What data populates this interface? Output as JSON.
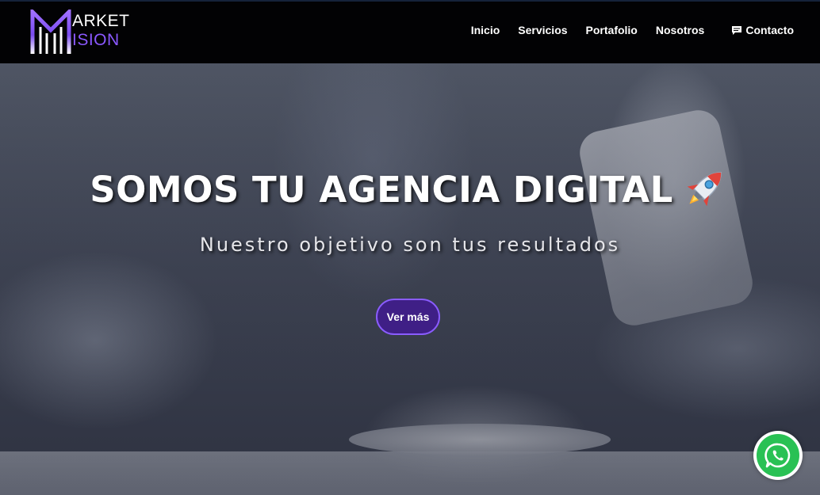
{
  "brand": {
    "mark_letter": "M",
    "logo_top": "ARKET",
    "logo_bottom": "ISION"
  },
  "nav": {
    "items": [
      {
        "label": "Inicio"
      },
      {
        "label": "Servicios"
      },
      {
        "label": "Portafolio"
      },
      {
        "label": "Nosotros"
      },
      {
        "label": "Contacto",
        "icon": "chat-icon"
      }
    ]
  },
  "hero": {
    "title": "SOMOS TU AGENCIA DIGITAL",
    "title_icon": "rocket-icon",
    "subtitle": "Nuestro objetivo son tus resultados",
    "cta_label": "Ver más",
    "background": "blurred-photo-hands-smartphone-coffee-cup"
  },
  "floating": {
    "whatsapp_icon": "whatsapp-icon"
  },
  "colors": {
    "navbar_bg": "#020204",
    "accent_purple": "#8a58ff",
    "cta_bg": "#3f1f86",
    "whatsapp_green": "#29c154",
    "text_white": "#ffffff"
  }
}
